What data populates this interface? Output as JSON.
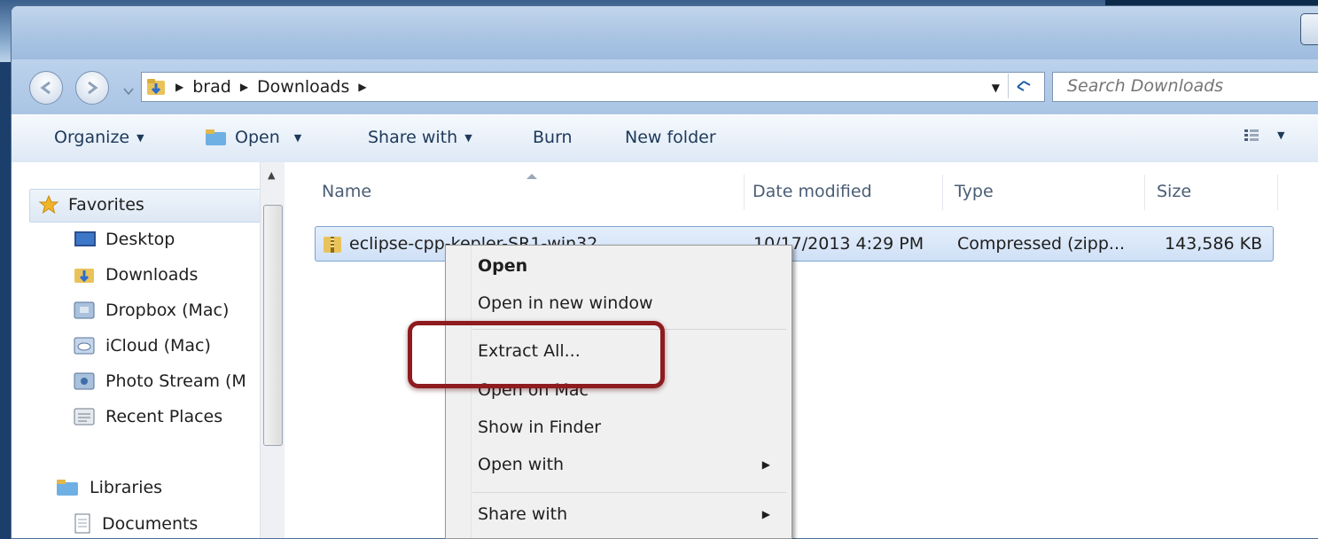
{
  "address": {
    "crumbs": [
      "brad",
      "Downloads"
    ],
    "search_placeholder": "Search Downloads"
  },
  "toolbar": {
    "organize": "Organize",
    "open": "Open",
    "share_with": "Share with",
    "burn": "Burn",
    "new_folder": "New folder"
  },
  "sidebar": {
    "favorites": "Favorites",
    "items": [
      "Desktop",
      "Downloads",
      "Dropbox (Mac)",
      "iCloud (Mac)",
      "Photo Stream (M",
      "Recent Places"
    ],
    "libraries": "Libraries",
    "library_items": [
      "Documents"
    ]
  },
  "columns": [
    "Name",
    "Date modified",
    "Type",
    "Size"
  ],
  "files": [
    {
      "name": "eclipse-cpp-kepler-SR1-win32",
      "date": "10/17/2013 4:29 PM",
      "type": "Compressed (zipp...",
      "size": "143,586 KB"
    }
  ],
  "context_menu": {
    "items": [
      "Open",
      "Open in new window",
      "Extract All...",
      "Open on Mac",
      "Show in Finder",
      "Open with",
      "Share with"
    ]
  },
  "colors": {
    "highlight": "#8e1b1f",
    "selection": "#cfe0f6"
  }
}
